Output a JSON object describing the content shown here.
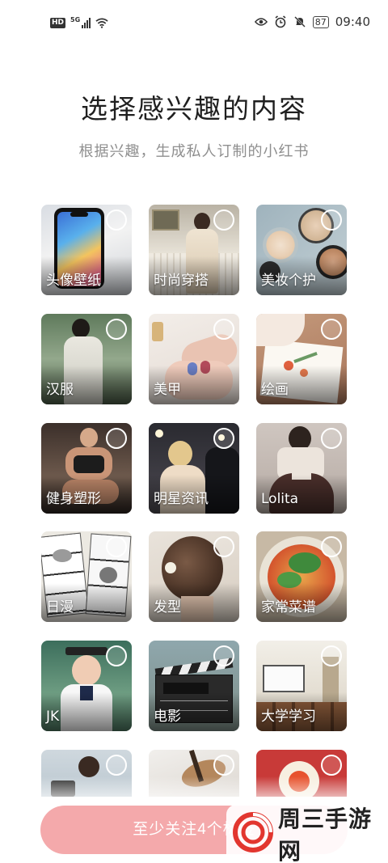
{
  "status_bar": {
    "hd": "HD",
    "network": "5G",
    "battery": "87",
    "time": "09:40",
    "icons": [
      "hd-badge",
      "signal-icon",
      "wifi-icon",
      "eye-icon",
      "alarm-icon",
      "mute-icon",
      "battery-icon"
    ]
  },
  "header": {
    "title": "选择感兴趣的内容",
    "subtitle": "根据兴趣，生成私人订制的小红书"
  },
  "categories": [
    {
      "label": "头像壁纸",
      "selected": false
    },
    {
      "label": "时尚穿搭",
      "selected": false
    },
    {
      "label": "美妆个护",
      "selected": false
    },
    {
      "label": "汉服",
      "selected": false
    },
    {
      "label": "美甲",
      "selected": false
    },
    {
      "label": "绘画",
      "selected": false
    },
    {
      "label": "健身塑形",
      "selected": false
    },
    {
      "label": "明星资讯",
      "selected": false
    },
    {
      "label": "Lolita",
      "selected": false
    },
    {
      "label": "日漫",
      "selected": false
    },
    {
      "label": "发型",
      "selected": false
    },
    {
      "label": "家常菜谱",
      "selected": false
    },
    {
      "label": "JK",
      "selected": false
    },
    {
      "label": "电影",
      "selected": false
    },
    {
      "label": "大学学习",
      "selected": false
    },
    {
      "label": "",
      "selected": false
    },
    {
      "label": "",
      "selected": false
    },
    {
      "label": "",
      "selected": false
    }
  ],
  "cta": {
    "label": "至少关注4个标签"
  },
  "watermark": {
    "text": "周三手游网"
  },
  "colors": {
    "accent": "#f4a9ab",
    "title": "#1f1f1f",
    "subtitle": "#8f8f8f"
  }
}
